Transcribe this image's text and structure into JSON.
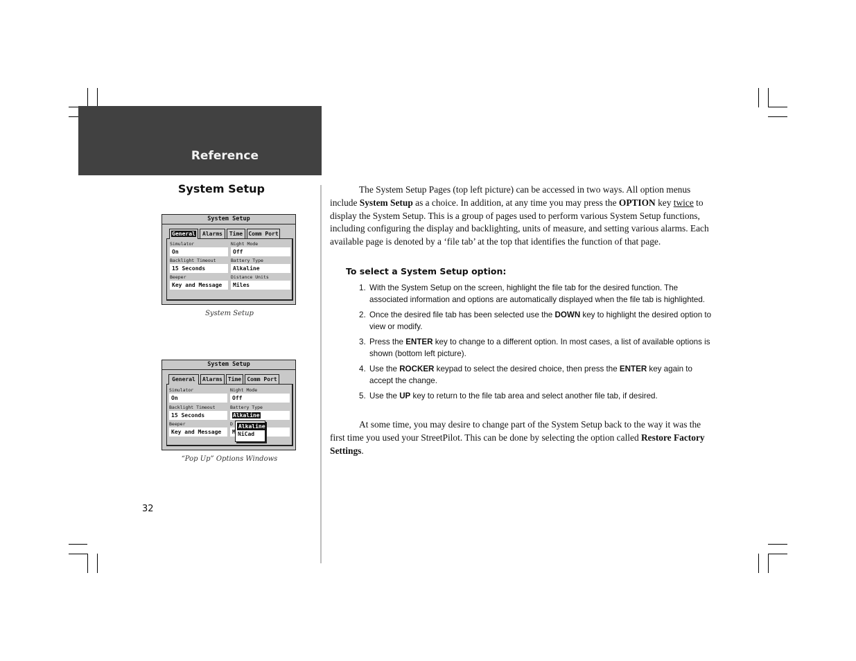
{
  "header": {
    "band_title": "Reference",
    "band_color": "#414141"
  },
  "left": {
    "section_title": "System Setup",
    "screen1": {
      "title": "System Setup",
      "tabs": [
        "General",
        "Alarms",
        "Time",
        "Comm Port"
      ],
      "active_tab": "General",
      "fields": [
        {
          "label": "Simulator",
          "value": "On"
        },
        {
          "label": "Night Mode",
          "value": "Off"
        },
        {
          "label": "Backlight Timeout",
          "value": "15 Seconds"
        },
        {
          "label": "Battery Type",
          "value": "Alkaline"
        },
        {
          "label": "Beeper",
          "value": "Key and Message"
        },
        {
          "label": "Distance Units",
          "value": "Miles"
        }
      ],
      "caption": "System Setup"
    },
    "screen2": {
      "title": "System Setup",
      "tabs": [
        "General",
        "Alarms",
        "Time",
        "Comm Port"
      ],
      "active_tab": "General",
      "fields": [
        {
          "label": "Simulator",
          "value": "On"
        },
        {
          "label": "Night Mode",
          "value": "Off"
        },
        {
          "label": "Backlight Timeout",
          "value": "15 Seconds"
        },
        {
          "label": "Battery Type",
          "value": "Alkaline"
        },
        {
          "label": "Beeper",
          "value": "Key and Message"
        },
        {
          "label": "D",
          "value": "M"
        }
      ],
      "popup_options": [
        "Alkaline",
        "NiCad"
      ],
      "popup_selected": "Alkaline",
      "caption": "“Pop Up” Options Windows"
    },
    "page_number": "32"
  },
  "right": {
    "intro": {
      "p1": "The System Setup Pages (top left picture) can be accessed in two ways.  All option menus include ",
      "b1": "System Setup",
      "p2": " as a choice.  In addition, at any time you may press the ",
      "b2": "OPTION",
      "p3": " key ",
      "u1": "twice",
      "p4": " to display the System Setup.  This is a group of pages used to perform various System Setup functions, including configuring the display and backlighting, units of measure, and setting various alarms.  Each available page is denoted by a ‘file tab’ at the top that identifies the function of that page."
    },
    "procedure_title": "To select a System Setup option:",
    "steps": [
      {
        "num": "1.",
        "parts": [
          {
            "t": "With the System Setup on the screen, highlight the file tab for the desired function. The associated information and options are automatically displayed when the file tab is highlighted."
          }
        ]
      },
      {
        "num": "2.",
        "parts": [
          {
            "t": "Once the desired file tab has been selected use the "
          },
          {
            "b": "DOWN"
          },
          {
            "t": " key to highlight the desired option to view or modify."
          }
        ]
      },
      {
        "num": "3.",
        "parts": [
          {
            "t": "Press the "
          },
          {
            "b": "ENTER"
          },
          {
            "t": " key to change to a different option.  In most cases, a list of available options is shown (bottom left picture)."
          }
        ]
      },
      {
        "num": "4.",
        "parts": [
          {
            "t": "Use the "
          },
          {
            "b": "ROCKER"
          },
          {
            "t": " keypad to select the desired choice, then press the "
          },
          {
            "b": "ENTER"
          },
          {
            "t": " key again to accept the change."
          }
        ]
      },
      {
        "num": "5.",
        "parts": [
          {
            "t": "Use the "
          },
          {
            "b": "UP"
          },
          {
            "t": " key to return to the file tab area and select another file tab, if desired."
          }
        ]
      }
    ],
    "closing": {
      "p1": "At some time, you may desire to change part of the System Setup back to the way it was the first time you used your StreetPilot. This can be done by selecting the option called ",
      "b1": "Restore Factory Settings",
      "p2": "."
    }
  }
}
